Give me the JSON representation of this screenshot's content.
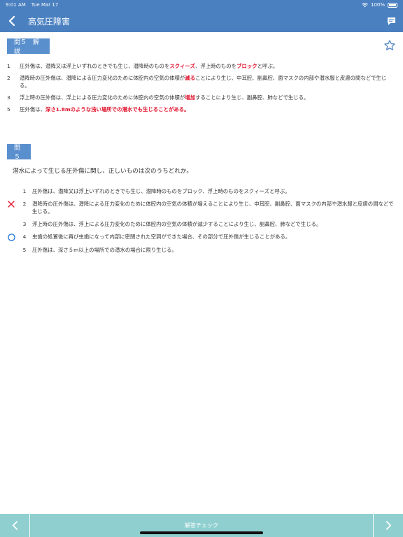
{
  "status_bar": {
    "time": "9:01 AM",
    "date": "Tue Mar 17",
    "battery": "100%"
  },
  "nav": {
    "title": "高気圧障害",
    "back_icon": "chevron-left-icon",
    "comment_icon": "comment-icon"
  },
  "explanation": {
    "label": "問５　解説",
    "items": [
      {
        "num": "1",
        "parts": [
          {
            "t": "圧外傷は、潜降又は浮上いずれのときでも生じ、潜降時のものを"
          },
          {
            "t": "スクィーズ",
            "hl": true
          },
          {
            "t": "、浮上時のものを"
          },
          {
            "t": "ブロック",
            "hl": true
          },
          {
            "t": "と呼ぶ。"
          }
        ]
      },
      {
        "num": "2",
        "parts": [
          {
            "t": "潜降時の圧外傷は、潜降による圧力変化のために体腔内の空気の体積が"
          },
          {
            "t": "減る",
            "hl": true
          },
          {
            "t": "ことにより生じ、中耳腔、副鼻腔、面マスクの内部や潜水服と皮膚の間などで生じる。"
          }
        ]
      },
      {
        "num": "3",
        "parts": [
          {
            "t": "浮上時の圧外傷は、浮上による圧力変化のために体腔内の空気の体積が"
          },
          {
            "t": "増加",
            "hl": true
          },
          {
            "t": "することにより生じ、副鼻腔、肺などで生じる。"
          }
        ]
      },
      {
        "num": "5",
        "parts": [
          {
            "t": "圧外傷は、"
          },
          {
            "t": "深さ1.8mのような浅い場所での潜水でも生じることがある。",
            "hl": true
          }
        ]
      }
    ]
  },
  "question": {
    "label": "問５",
    "text": "潜水によって生じる圧外傷に関し、正しいものは次のうちどれか。",
    "choices": [
      {
        "num": "1",
        "text": "圧外傷は、潜降又は浮上いずれのときでも生じ、潜降時のものをブロック、浮上時のものをスクィーズと呼ぶ。",
        "mark": ""
      },
      {
        "num": "2",
        "text": "潜降時の圧外傷は、潜降による圧力変化のために体腔内の空気の体積が増えることにより生じ、中耳腔、副鼻腔、面マスクの内部や潜水服と皮膚の間などで生じる。",
        "mark": "wrong"
      },
      {
        "num": "3",
        "text": "浮上時の圧外傷は、浮上による圧力変化のために体腔内の空気の体積が減少することにより生じ、副鼻腔、肺などで生じる。",
        "mark": ""
      },
      {
        "num": "4",
        "text": "虫歯の処置後に再び虫歯になって内部に密閉された空洞ができた場合、その部分で圧外傷が生じることがある。",
        "mark": "correct"
      },
      {
        "num": "5",
        "text": "圧外傷は、深さ５m以上の場所での潜水の場合に限り生じる。",
        "mark": ""
      }
    ]
  },
  "bottom_bar": {
    "check_label": "解答チェック",
    "prev_icon": "chevron-left-icon",
    "next_icon": "chevron-right-icon"
  },
  "colors": {
    "header": "#4a80c0",
    "label_bg": "#5a8fce",
    "highlight": "#e0112b",
    "bottom_bar": "#8fcfcf"
  }
}
